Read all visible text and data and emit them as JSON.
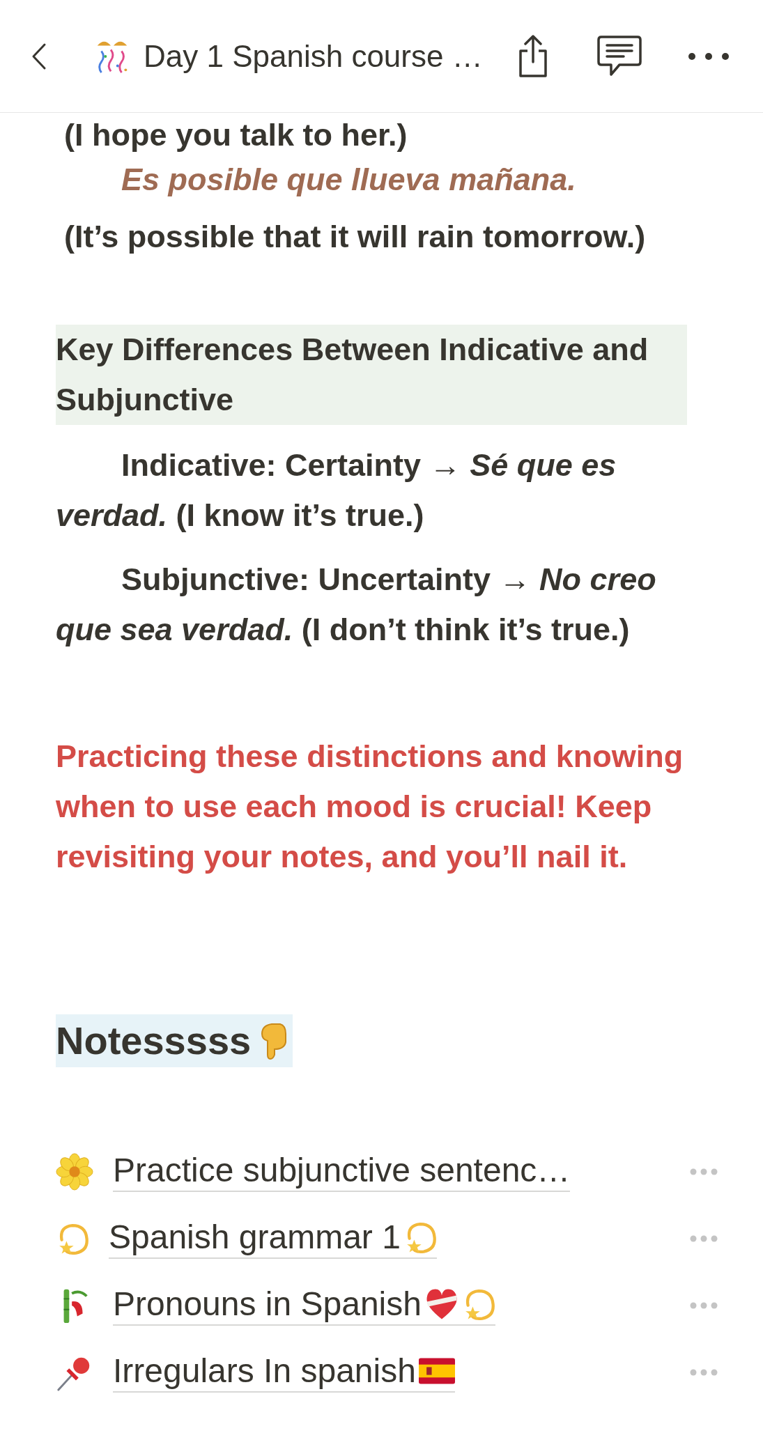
{
  "header": {
    "title": "Day 1 Spanish course …"
  },
  "blocks": [
    {
      "kind": "cut",
      "text": "(I hope you talk to her.)"
    },
    {
      "kind": "example",
      "text": "Es posible que llueva mañana."
    },
    {
      "kind": "plain",
      "text": "(It’s possible that it will rain tomorrow.)"
    },
    {
      "kind": "highlight",
      "text": "Key Differences Between Indicative and Subjunctive"
    },
    {
      "kind": "indented",
      "text": "Indicative: Certainty → *Sé que es verdad.* (I know it’s true.)"
    },
    {
      "kind": "indented",
      "text": "Subjunctive: Uncertainty → *No creo que sea verdad.* (I don’t think it’s true.)"
    },
    {
      "kind": "red",
      "text": "Practicing these distinctions and knowing when to use each mood is crucial! Keep revisiting your notes, and you’ll nail it."
    },
    {
      "kind": "heading",
      "text": "Notesssss"
    }
  ],
  "pages": [
    {
      "title": "Practice subjunctive sentenc…"
    },
    {
      "title": "Spanish grammar 1"
    },
    {
      "title": "Pronouns in Spanish "
    },
    {
      "title": "Irregulars In spanish "
    }
  ]
}
